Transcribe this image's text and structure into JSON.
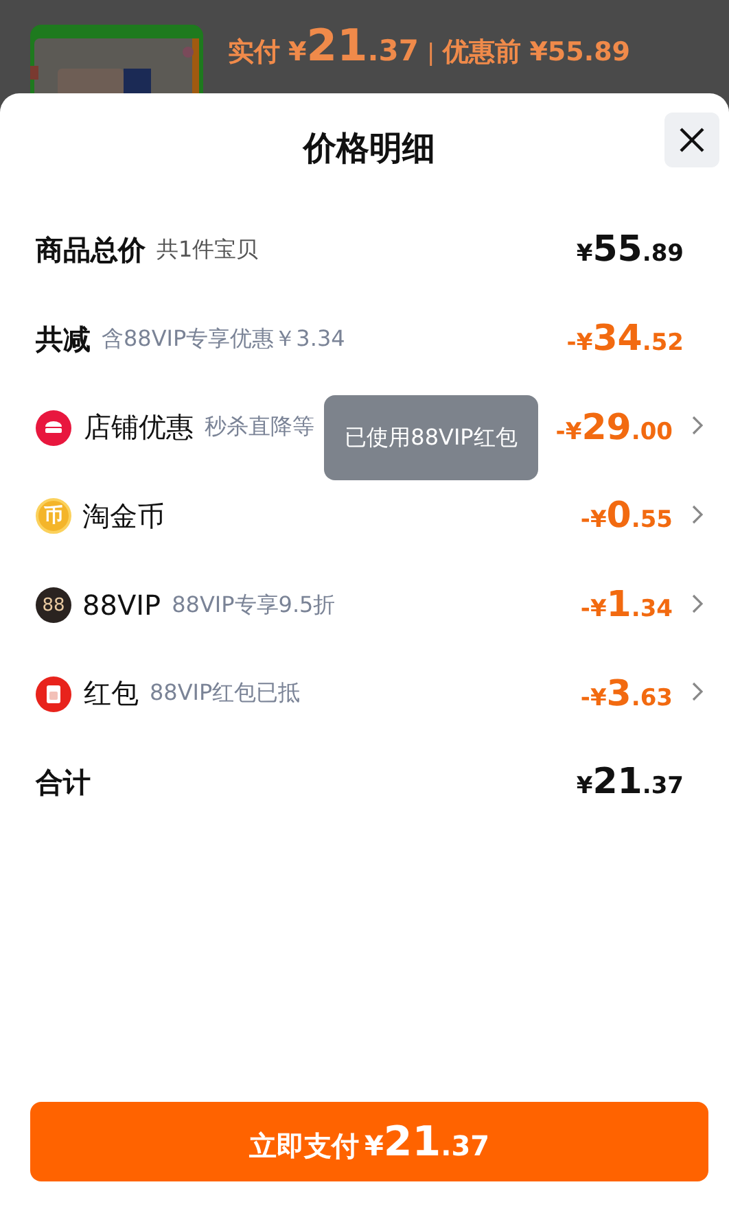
{
  "background": {
    "paid_label": "实付",
    "paid": {
      "currency": "¥",
      "whole": "21",
      "fraction": ".37"
    },
    "separator": "|",
    "before_label": "优惠前",
    "before": "¥55.89"
  },
  "sheet": {
    "title": "价格明细",
    "rows": [
      {
        "kind": "summary",
        "label": "商品总价",
        "note": "共1件宝贝",
        "amount": {
          "currency": "¥",
          "whole": "55",
          "fraction": ".89"
        }
      },
      {
        "kind": "reduction",
        "label": "共减",
        "note": "含88VIP专享优惠￥3.34",
        "amount": {
          "currency": "-¥",
          "whole": "34",
          "fraction": ".52"
        }
      },
      {
        "kind": "shop",
        "label": "店铺优惠",
        "note": "秒杀直降等",
        "amount": {
          "currency": "-¥",
          "whole": "29",
          "fraction": ".00"
        }
      },
      {
        "kind": "coin",
        "icon_text": "币",
        "label": "淘金币",
        "amount": {
          "currency": "-¥",
          "whole": "0",
          "fraction": ".55"
        }
      },
      {
        "kind": "vip",
        "icon_text": "88",
        "label": "88VIP",
        "note": "88VIP专享9.5折",
        "amount": {
          "currency": "-¥",
          "whole": "1",
          "fraction": ".34"
        }
      },
      {
        "kind": "packet",
        "label": "红包",
        "note": "88VIP红包已抵",
        "amount": {
          "currency": "-¥",
          "whole": "3",
          "fraction": ".63"
        }
      },
      {
        "kind": "summary",
        "label": "合计",
        "amount": {
          "currency": "¥",
          "whole": "21",
          "fraction": ".37"
        }
      }
    ],
    "toast": "已使用88VIP红包",
    "pay_button": {
      "label": "立即支付",
      "amount": {
        "currency": "¥",
        "whole": "21",
        "fraction": ".37"
      }
    }
  }
}
